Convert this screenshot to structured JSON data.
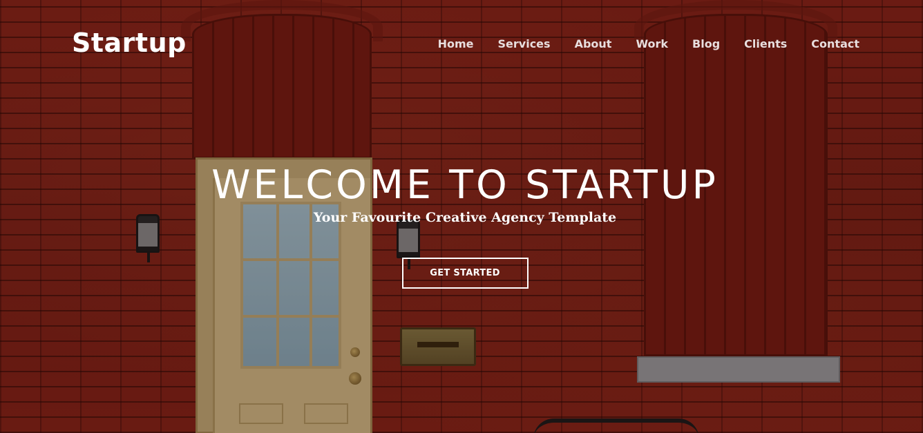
{
  "header": {
    "logo": "Startup",
    "nav": [
      "Home",
      "Services",
      "About",
      "Work",
      "Blog",
      "Clients",
      "Contact"
    ]
  },
  "hero": {
    "title": "WELCOME TO STARTUP",
    "subtitle": "Your Favourite Creative Agency Template",
    "cta_label": "GET STARTED",
    "background": "brick-wall-photo"
  },
  "colors": {
    "text": "#ffffff",
    "brick": "#8a2418"
  }
}
